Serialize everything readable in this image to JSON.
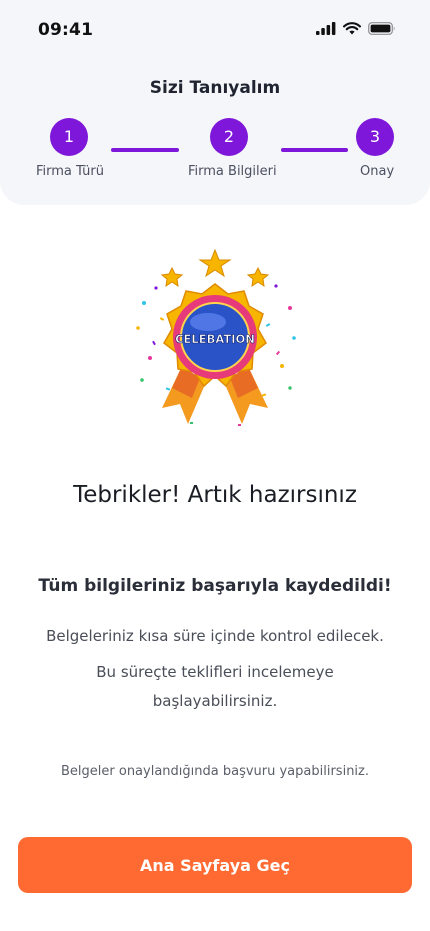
{
  "status_bar": {
    "time": "09:41"
  },
  "header": {
    "title": "Sizi Tanıyalım"
  },
  "stepper": {
    "steps": [
      {
        "number": "1",
        "label": "Firma Türü"
      },
      {
        "number": "2",
        "label": "Firma Bilgileri"
      },
      {
        "number": "3",
        "label": "Onay"
      }
    ],
    "current_step": 3
  },
  "badge": {
    "text": "CELEBATION"
  },
  "content": {
    "headline": "Tebrikler! Artık hazırsınız",
    "subhead": "Tüm bilgileriniz başarıyla kaydedildi!",
    "line1": "Belgeleriniz kısa süre içinde kontrol edilecek.",
    "line2": "Bu süreçte teklifleri incelemeye başlayabilirsiniz.",
    "note": "Belgeler onaylandığında başvuru yapabilirsiniz."
  },
  "cta": {
    "label": "Ana Sayfaya Geç"
  },
  "colors": {
    "accent": "#7e17d9",
    "cta": "#ff6a32"
  }
}
